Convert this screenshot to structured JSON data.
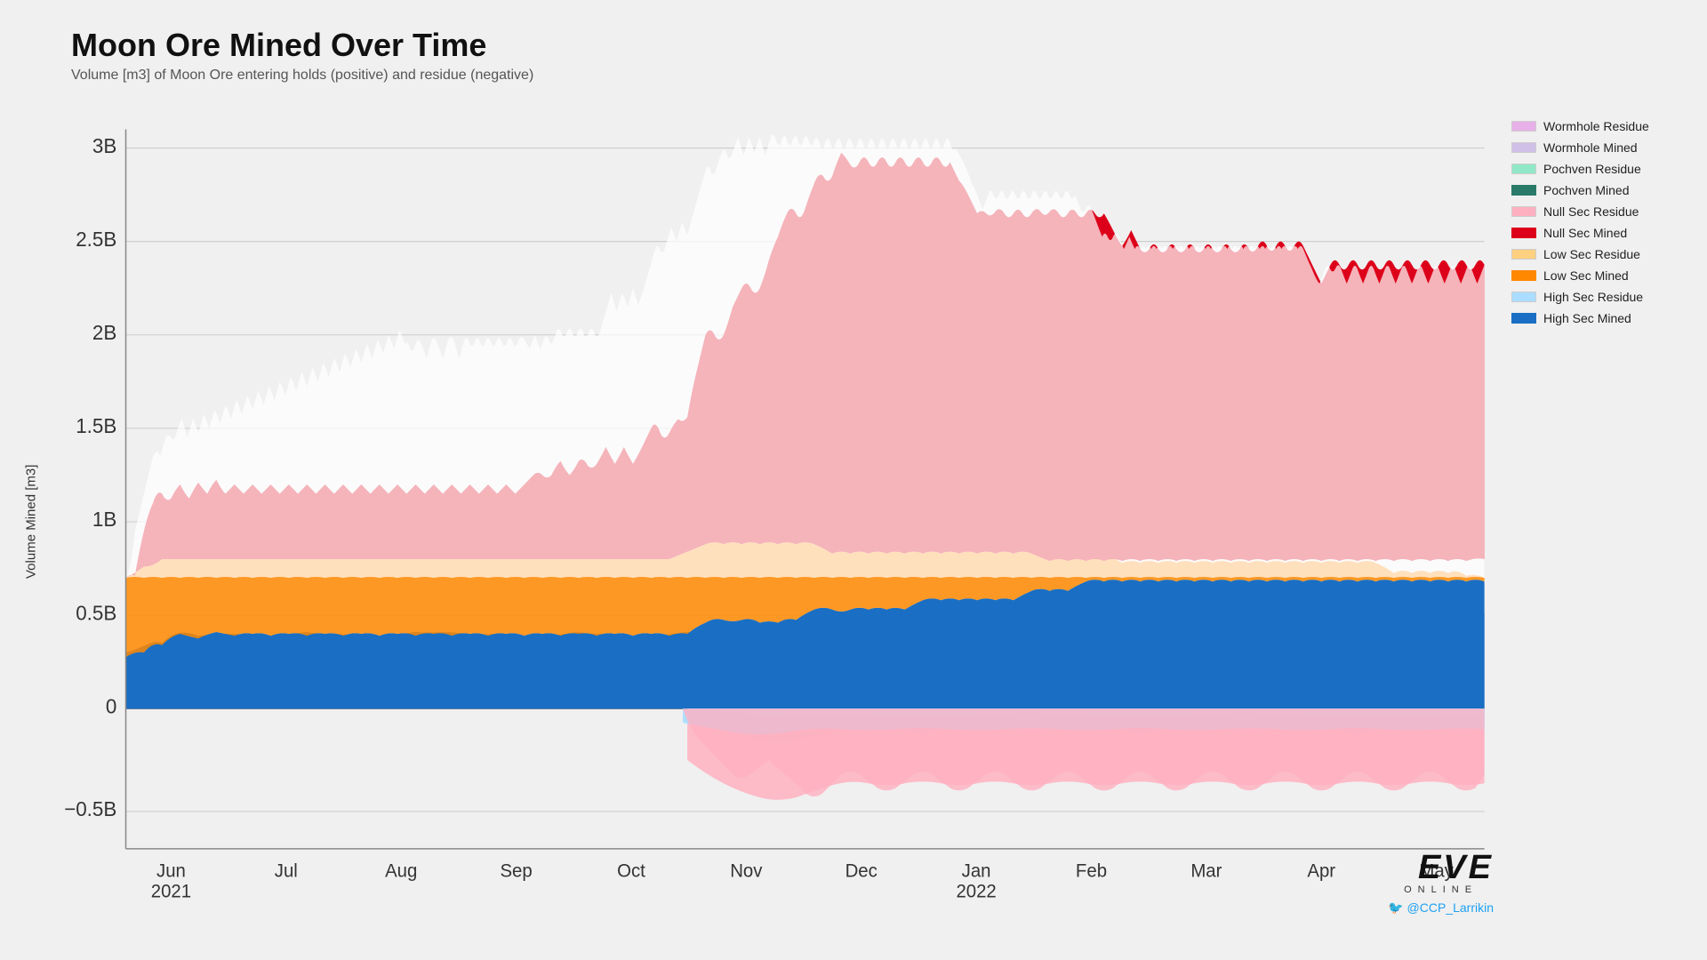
{
  "title": "Moon Ore Mined Over Time",
  "subtitle": "Volume [m3] of Moon Ore entering holds (positive) and residue (negative)",
  "y_axis_label": "Volume Mined [m3]",
  "x_axis_labels": [
    "Jun\n2021",
    "Jul",
    "Aug",
    "Sep",
    "Oct",
    "Nov",
    "Dec",
    "Jan\n2022",
    "Feb",
    "Mar",
    "Apr",
    "May"
  ],
  "y_axis_ticks": [
    "3B",
    "2.5B",
    "2B",
    "1.5B",
    "1B",
    "0.5B",
    "0",
    "-0.5B"
  ],
  "legend": [
    {
      "label": "Wormhole Residue",
      "color": "#e8b4e8"
    },
    {
      "label": "Wormhole Mined",
      "color": "#d0c0e8"
    },
    {
      "label": "Pochven Residue",
      "color": "#b0e8d0"
    },
    {
      "label": "Pochven Mined",
      "color": "#2a7a6a"
    },
    {
      "label": "Null Sec Residue",
      "color": "#ffb0c0"
    },
    {
      "label": "Null Sec Mined",
      "color": "#e8001a"
    },
    {
      "label": "Low Sec Residue",
      "color": "#ffcc88"
    },
    {
      "label": "Low Sec Mined",
      "color": "#ff8800"
    },
    {
      "label": "High Sec Residue",
      "color": "#aaddff"
    },
    {
      "label": "High Sec Mined",
      "color": "#0055cc"
    }
  ],
  "twitter": "@CCP_Larrikin",
  "eve_logo": "EVE",
  "eve_sub": "ONLINE",
  "colors": {
    "high_sec_mined": "#1a6fc4",
    "high_sec_residue": "#b0d8f8",
    "low_sec_mined": "#ff8800",
    "low_sec_residue": "#ffd080",
    "null_sec_mined": "#dd001a",
    "null_sec_residue": "#ffaabb",
    "wormhole_mined": "#c8b8e8",
    "wormhole_residue": "#e0b8e8",
    "pochven_mined": "#2a8a6a",
    "pochven_residue": "#90d8b8",
    "background": "#f0f0f0",
    "grid": "#cccccc"
  }
}
